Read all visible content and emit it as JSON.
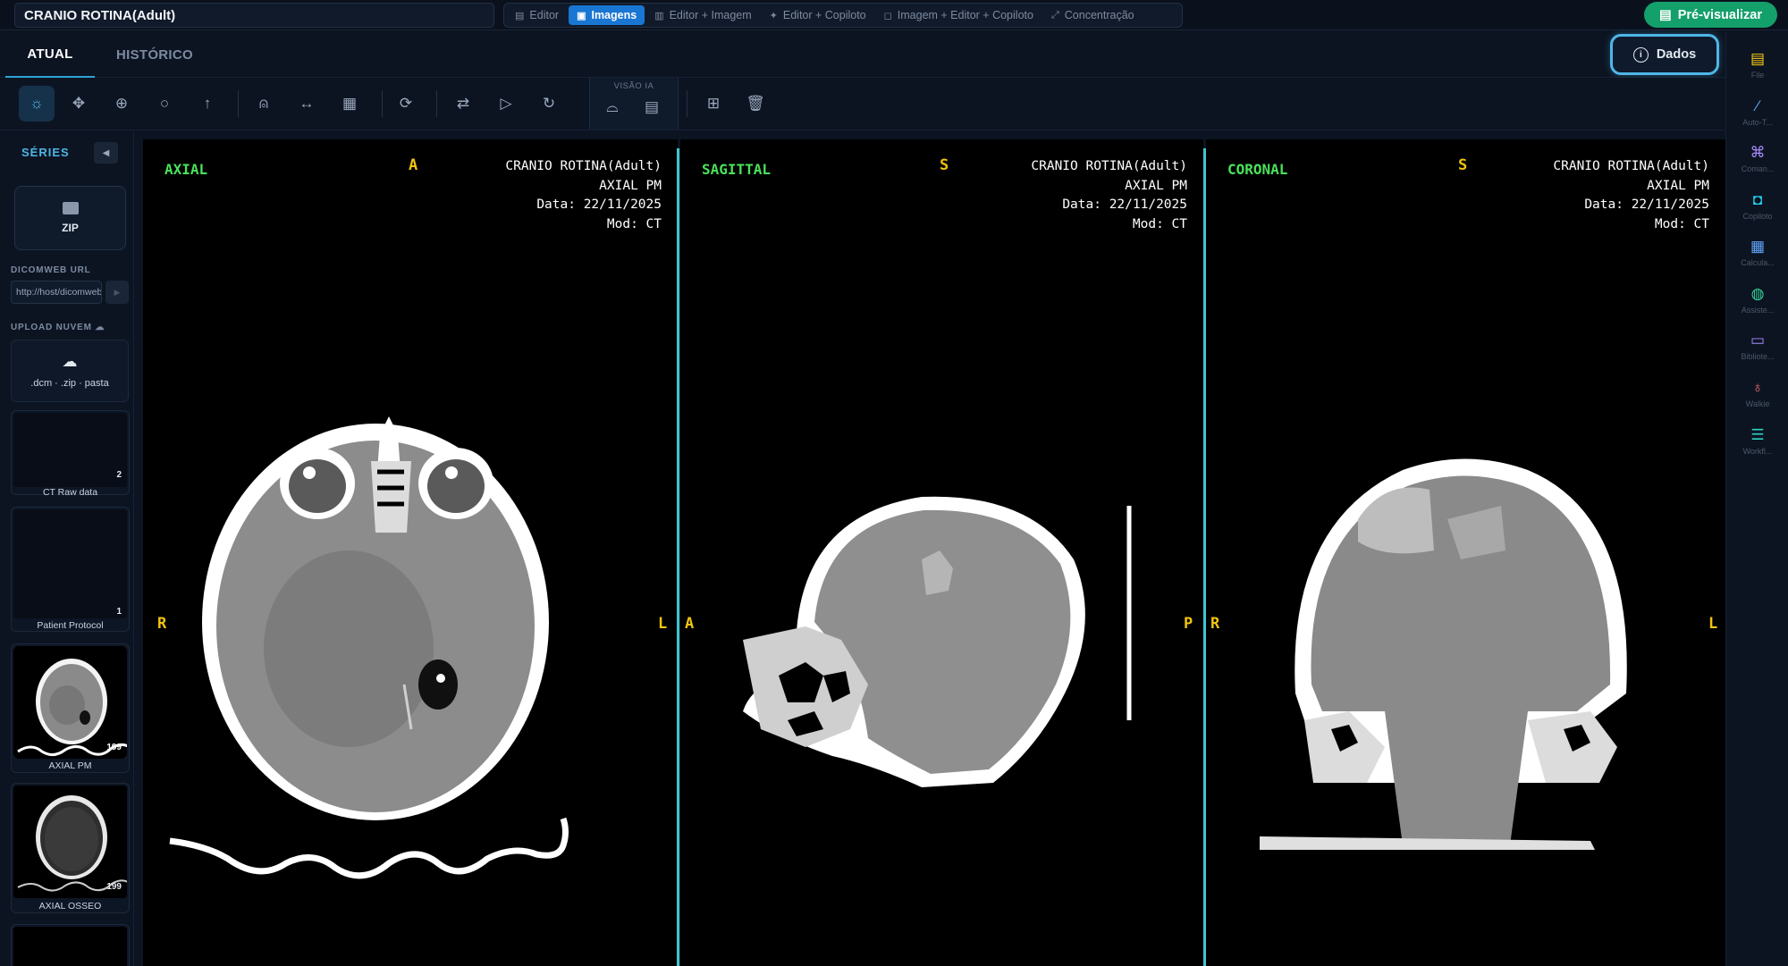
{
  "study_title": "CRANIO ROTINA(Adult)",
  "modes": [
    {
      "label": "Editor",
      "icon": "document-icon",
      "active": false
    },
    {
      "label": "Imagens",
      "icon": "image-icon",
      "active": true
    },
    {
      "label": "Editor + Imagem",
      "icon": "split-icon",
      "active": false
    },
    {
      "label": "Editor + Copiloto",
      "icon": "sparkle-icon",
      "active": false
    },
    {
      "label": "Imagem + Editor + Copiloto",
      "icon": "bot-icon",
      "active": false
    },
    {
      "label": "Concentração",
      "icon": "expand-icon",
      "active": false
    }
  ],
  "preview_button": "Pré-visualizar",
  "tabs": [
    {
      "label": "ATUAL",
      "active": true
    },
    {
      "label": "HISTÓRICO",
      "active": false
    }
  ],
  "dados_button": "Dados",
  "toolbar": {
    "ia_group_label": "VISÃO IA",
    "tools": [
      "brightness-icon",
      "pan-icon",
      "zoom-icon",
      "magnify-icon",
      "arrow-up-icon",
      "person-icon",
      "measure-icon",
      "layout-icon",
      "reset-icon",
      "flip-icon",
      "play-icon",
      "rotate-icon",
      "ai-scan-icon",
      "ai-report-icon",
      "grid-icon",
      "trash-icon"
    ]
  },
  "sidebar": {
    "title": "SÉRIES",
    "zip_label": "ZIP",
    "dicomweb_label": "DICOMWEB URL",
    "dicomweb_placeholder": "http://host/dicomweb",
    "upload_label": "UPLOAD NUVEM",
    "upload_hint": ".dcm · .zip · pasta",
    "series": [
      {
        "label": "CT Raw data",
        "count": "2",
        "thumb": "empty"
      },
      {
        "label": "Patient Protocol",
        "count": "1",
        "thumb": "empty"
      },
      {
        "label": "AXIAL PM",
        "count": "199",
        "thumb": "brain"
      },
      {
        "label": "AXIAL OSSEO",
        "count": "199",
        "thumb": "bone"
      }
    ]
  },
  "right_sidebar": [
    {
      "label": "File",
      "icon": "clipboard-icon",
      "color": "#facc15"
    },
    {
      "label": "Auto-T...",
      "icon": "wand-icon",
      "color": "#60a5fa"
    },
    {
      "label": "Coman...",
      "icon": "command-icon",
      "color": "#a78bfa"
    },
    {
      "label": "Copiloto",
      "icon": "bot-icon",
      "color": "#22d3ee"
    },
    {
      "label": "Calcula...",
      "icon": "calculator-icon",
      "color": "#60a5fa"
    },
    {
      "label": "Assiste...",
      "icon": "globe-icon",
      "color": "#34d399"
    },
    {
      "label": "Bibliote...",
      "icon": "book-icon",
      "color": "#a78bfa"
    },
    {
      "label": "Walkie",
      "icon": "mic-icon",
      "color": "#f87171"
    },
    {
      "label": "Workfl...",
      "icon": "sliders-icon",
      "color": "#2dd4bf"
    }
  ],
  "viewports": [
    {
      "name": "AXIAL",
      "top": "A",
      "left": "R",
      "right": "L",
      "info": [
        "CRANIO ROTINA(Adult)",
        "AXIAL PM",
        "Data: 22/11/2025",
        "Mod: CT"
      ]
    },
    {
      "name": "SAGITTAL",
      "top": "S",
      "left": "A",
      "right": "P",
      "info": [
        "CRANIO ROTINA(Adult)",
        "AXIAL PM",
        "Data: 22/11/2025",
        "Mod: CT"
      ]
    },
    {
      "name": "CORONAL",
      "top": "S",
      "left": "R",
      "right": "L",
      "info": [
        "CRANIO ROTINA(Adult)",
        "AXIAL PM",
        "Data: 22/11/2025",
        "Mod: CT"
      ]
    }
  ]
}
